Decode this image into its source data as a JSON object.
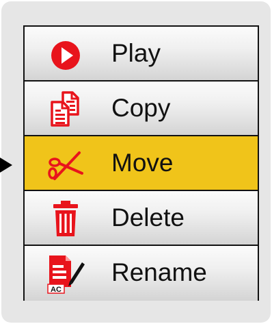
{
  "menu": {
    "items": [
      {
        "label": "Play",
        "icon": "play-icon",
        "selected": false
      },
      {
        "label": "Copy",
        "icon": "copy-icon",
        "selected": false
      },
      {
        "label": "Move",
        "icon": "scissors-icon",
        "selected": true
      },
      {
        "label": "Delete",
        "icon": "trash-icon",
        "selected": false
      },
      {
        "label": "Rename",
        "icon": "rename-icon",
        "selected": false
      }
    ],
    "rename_badge": "AC",
    "selected_color": "#f0c41a",
    "icon_color": "#e8141c"
  }
}
